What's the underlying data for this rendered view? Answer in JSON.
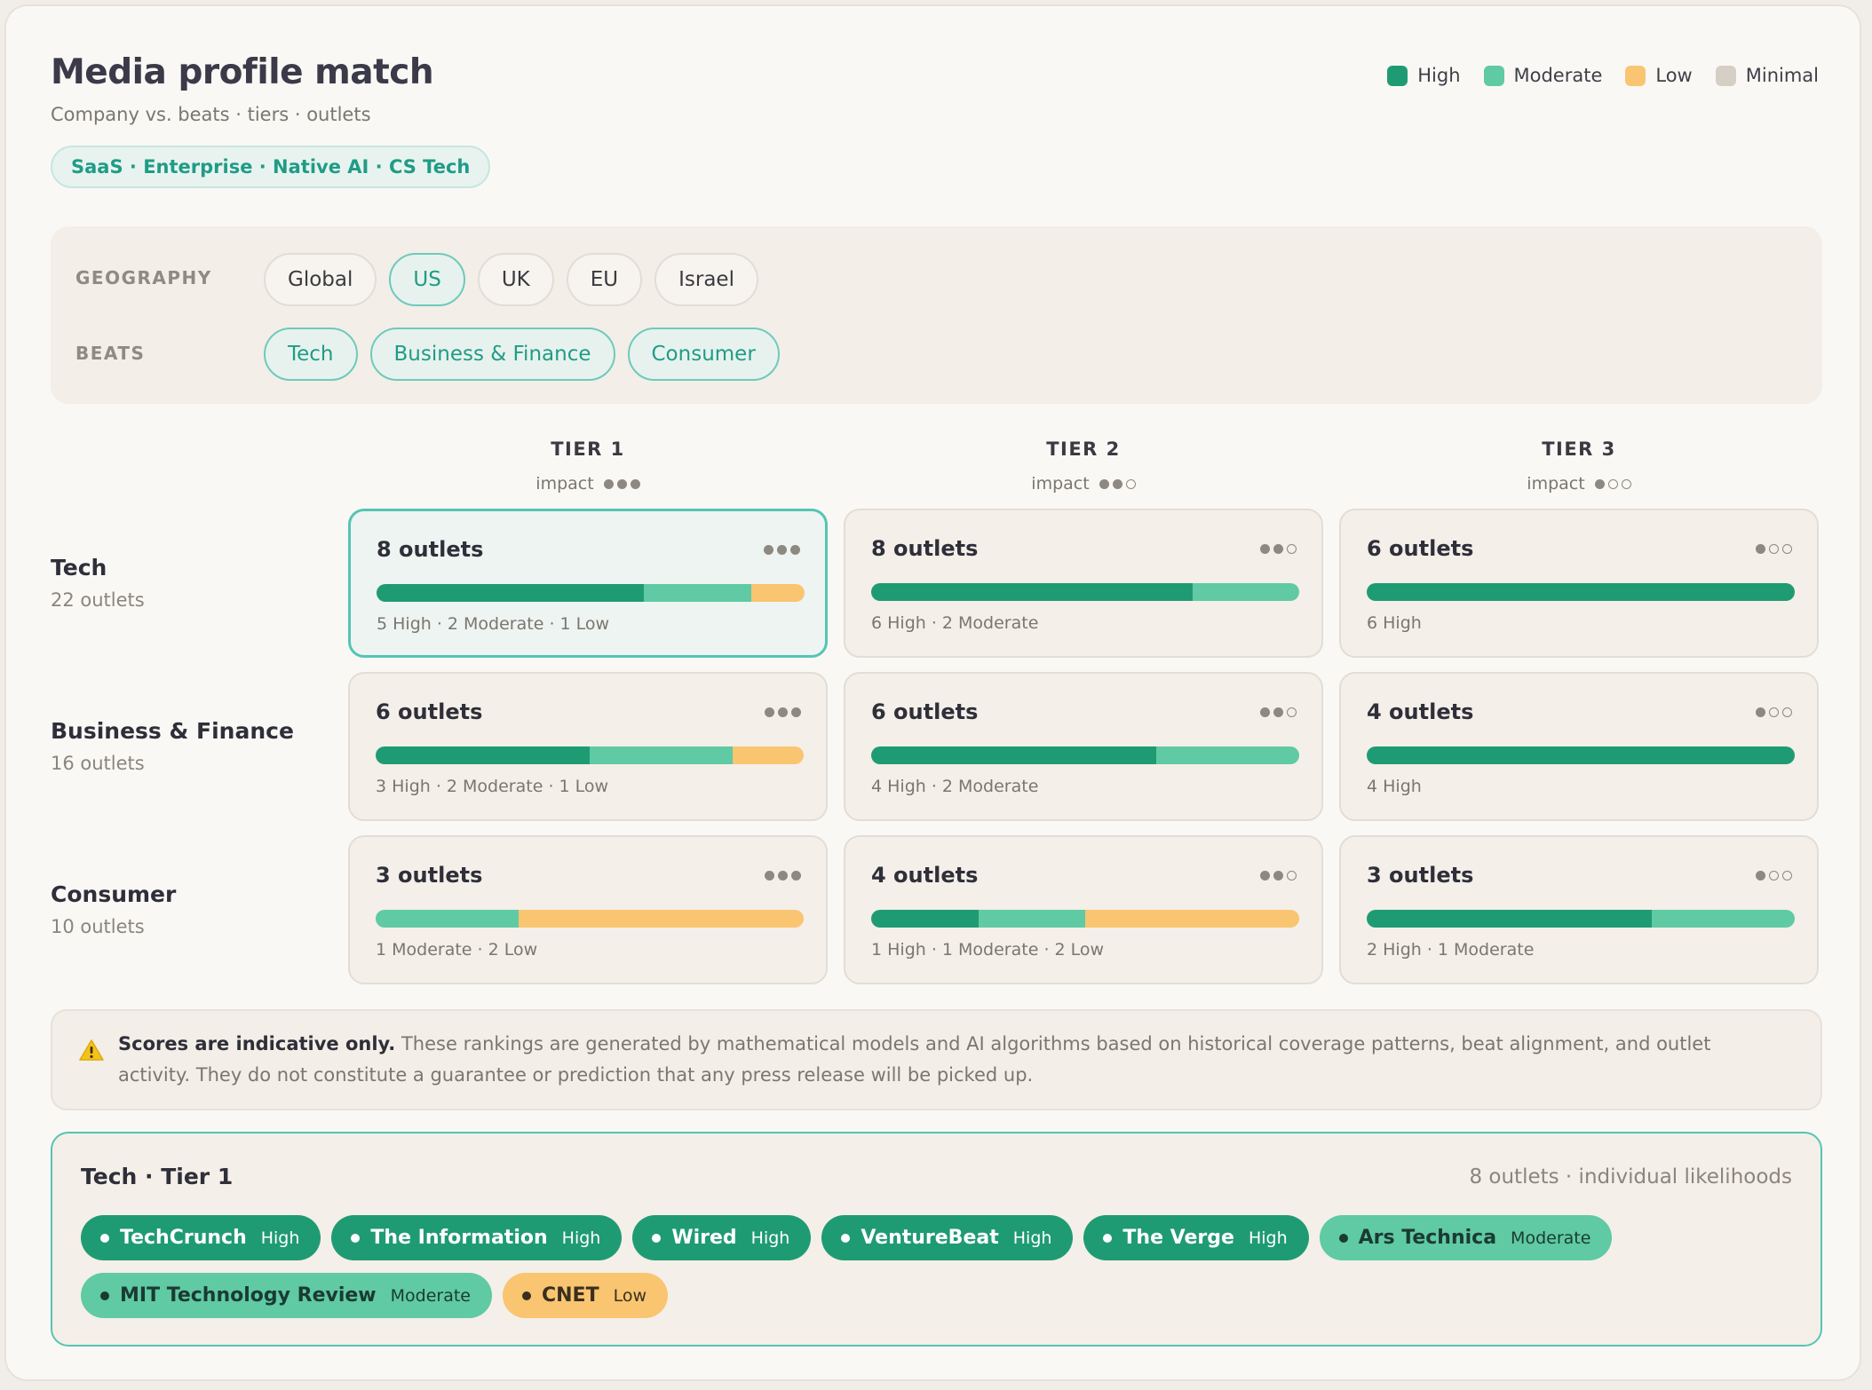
{
  "header": {
    "title": "Media profile match",
    "subtitle": "Company vs. beats · tiers · outlets",
    "profile_tag": "SaaS · Enterprise · Native AI · CS Tech"
  },
  "legend": [
    {
      "label": "High",
      "color": "#1f9b73"
    },
    {
      "label": "Moderate",
      "color": "#5fcaa3"
    },
    {
      "label": "Low",
      "color": "#f9c570"
    },
    {
      "label": "Minimal",
      "color": "#d6cfc5"
    }
  ],
  "filters": {
    "geography_label": "GEOGRAPHY",
    "geography": [
      {
        "label": "Global",
        "active": false
      },
      {
        "label": "US",
        "active": true
      },
      {
        "label": "UK",
        "active": false
      },
      {
        "label": "EU",
        "active": false
      },
      {
        "label": "Israel",
        "active": false
      }
    ],
    "beats_label": "BEATS",
    "beats": [
      {
        "label": "Tech",
        "active": true
      },
      {
        "label": "Business & Finance",
        "active": true
      },
      {
        "label": "Consumer",
        "active": true
      }
    ]
  },
  "tiers": [
    {
      "name": "TIER 1",
      "impact_label": "impact",
      "impact": 3
    },
    {
      "name": "TIER 2",
      "impact_label": "impact",
      "impact": 2
    },
    {
      "name": "TIER 3",
      "impact_label": "impact",
      "impact": 1
    }
  ],
  "rows": [
    {
      "name": "Tech",
      "count": "22 outlets",
      "cells": [
        {
          "title": "8 outlets",
          "high": 5,
          "moderate": 2,
          "low": 1,
          "summary": "5 High · 2 Moderate · 1 Low",
          "selected": true
        },
        {
          "title": "8 outlets",
          "high": 6,
          "moderate": 2,
          "low": 0,
          "summary": "6 High · 2 Moderate",
          "selected": false
        },
        {
          "title": "6 outlets",
          "high": 6,
          "moderate": 0,
          "low": 0,
          "summary": "6 High",
          "selected": false
        }
      ]
    },
    {
      "name": "Business & Finance",
      "count": "16 outlets",
      "cells": [
        {
          "title": "6 outlets",
          "high": 3,
          "moderate": 2,
          "low": 1,
          "summary": "3 High · 2 Moderate · 1 Low",
          "selected": false
        },
        {
          "title": "6 outlets",
          "high": 4,
          "moderate": 2,
          "low": 0,
          "summary": "4 High · 2 Moderate",
          "selected": false
        },
        {
          "title": "4 outlets",
          "high": 4,
          "moderate": 0,
          "low": 0,
          "summary": "4 High",
          "selected": false
        }
      ]
    },
    {
      "name": "Consumer",
      "count": "10 outlets",
      "cells": [
        {
          "title": "3 outlets",
          "high": 0,
          "moderate": 1,
          "low": 2,
          "summary": "1 Moderate · 2 Low",
          "selected": false
        },
        {
          "title": "4 outlets",
          "high": 1,
          "moderate": 1,
          "low": 2,
          "summary": "1 High · 1 Moderate · 2 Low",
          "selected": false
        },
        {
          "title": "3 outlets",
          "high": 2,
          "moderate": 1,
          "low": 0,
          "summary": "2 High · 1 Moderate",
          "selected": false
        }
      ]
    }
  ],
  "disclaimer": {
    "bold": "Scores are indicative only.",
    "text": " These rankings are generated by mathematical models and AI algorithms based on historical coverage patterns, beat alignment, and outlet activity. They do not constitute a guarantee or prediction that any press release will be picked up."
  },
  "detail": {
    "title": "Tech · Tier 1",
    "meta": "8 outlets · individual likelihoods",
    "outlets": [
      {
        "name": "TechCrunch",
        "level": "High"
      },
      {
        "name": "The Information",
        "level": "High"
      },
      {
        "name": "Wired",
        "level": "High"
      },
      {
        "name": "VentureBeat",
        "level": "High"
      },
      {
        "name": "The Verge",
        "level": "High"
      },
      {
        "name": "Ars Technica",
        "level": "Moderate"
      },
      {
        "name": "MIT Technology Review",
        "level": "Moderate"
      },
      {
        "name": "CNET",
        "level": "Low"
      }
    ]
  }
}
